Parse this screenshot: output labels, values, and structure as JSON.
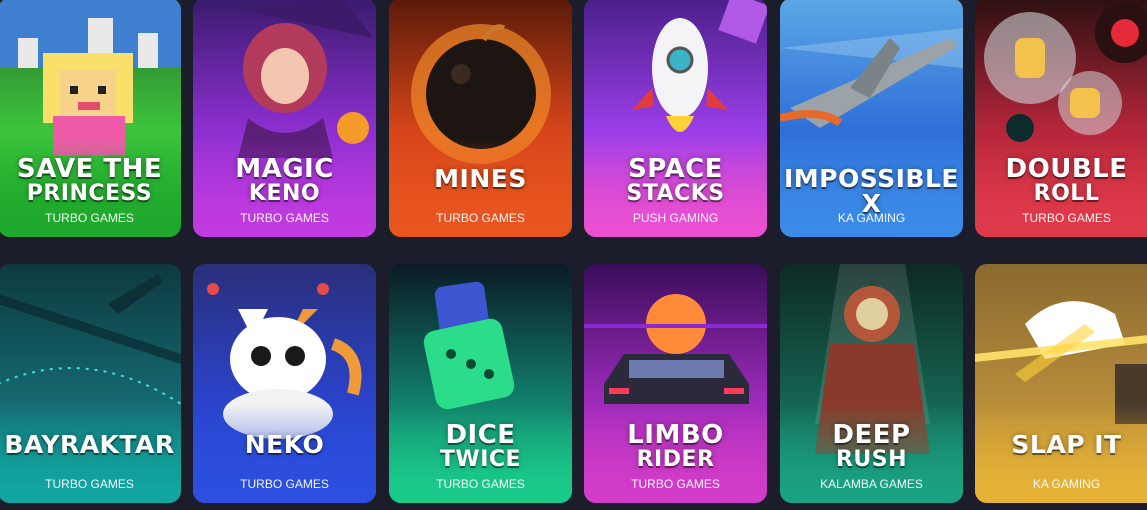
{
  "games": [
    {
      "title_line1": "SAVE THE",
      "title_line2": "PRINCESS",
      "provider": "TURBO GAMES",
      "art": "pixel-princess"
    },
    {
      "title_line1": "MAGIC",
      "title_line2": "KENO",
      "provider": "TURBO GAMES",
      "art": "witch"
    },
    {
      "title_line1": "MINES",
      "title_line2": "",
      "provider": "TURBO GAMES",
      "art": "bomb"
    },
    {
      "title_line1": "SPACE",
      "title_line2": "STACKS",
      "provider": "PUSH GAMING",
      "art": "rocket"
    },
    {
      "title_line1": "IMPOSSIBLE X",
      "title_line2": "",
      "provider": "KA GAMING",
      "art": "jet"
    },
    {
      "title_line1": "DOUBLE",
      "title_line2": "ROLL",
      "provider": "TURBO GAMES",
      "art": "hand-bubbles"
    },
    {
      "title_line1": "BAYRAKTAR",
      "title_line2": "",
      "provider": "TURBO GAMES",
      "art": "drone"
    },
    {
      "title_line1": "NEKO",
      "title_line2": "",
      "provider": "TURBO GAMES",
      "art": "cat"
    },
    {
      "title_line1": "DICE",
      "title_line2": "TWICE",
      "provider": "TURBO GAMES",
      "art": "dice"
    },
    {
      "title_line1": "LIMBO",
      "title_line2": "RIDER",
      "provider": "TURBO GAMES",
      "art": "car"
    },
    {
      "title_line1": "DEEP",
      "title_line2": "RUSH",
      "provider": "KALAMBA GAMES",
      "art": "diver"
    },
    {
      "title_line1": "SLAP IT",
      "title_line2": "",
      "provider": "KA GAMING",
      "art": "glove"
    }
  ],
  "colors": {
    "page_background": "#1b1d2b",
    "card_gradients": [
      [
        "#2b6d2b",
        "#3cc43c",
        "#1ea82c"
      ],
      [
        "#3a1b6e",
        "#8d2fd0",
        "#c03be0"
      ],
      [
        "#5a1a08",
        "#d6451a",
        "#e8551f"
      ],
      [
        "#4b1f8a",
        "#9a3ee8",
        "#ea4fd0"
      ],
      [
        "#5da7e6",
        "#2f6fd8",
        "#3a8ae8"
      ],
      [
        "#2c1010",
        "#b5263a",
        "#e03a4a"
      ],
      [
        "#0d3a40",
        "#15666e",
        "#12a6a0"
      ],
      [
        "#2a2f7a",
        "#2a42c8",
        "#2c4fe0"
      ],
      [
        "#0b1a24",
        "#117a6a",
        "#1acb8a"
      ],
      [
        "#3a0d5a",
        "#9a2ab8",
        "#d23cc8"
      ],
      [
        "#0e2a24",
        "#15604f",
        "#1aa383"
      ],
      [
        "#8a6a30",
        "#b58a3a",
        "#e6b236"
      ]
    ]
  }
}
